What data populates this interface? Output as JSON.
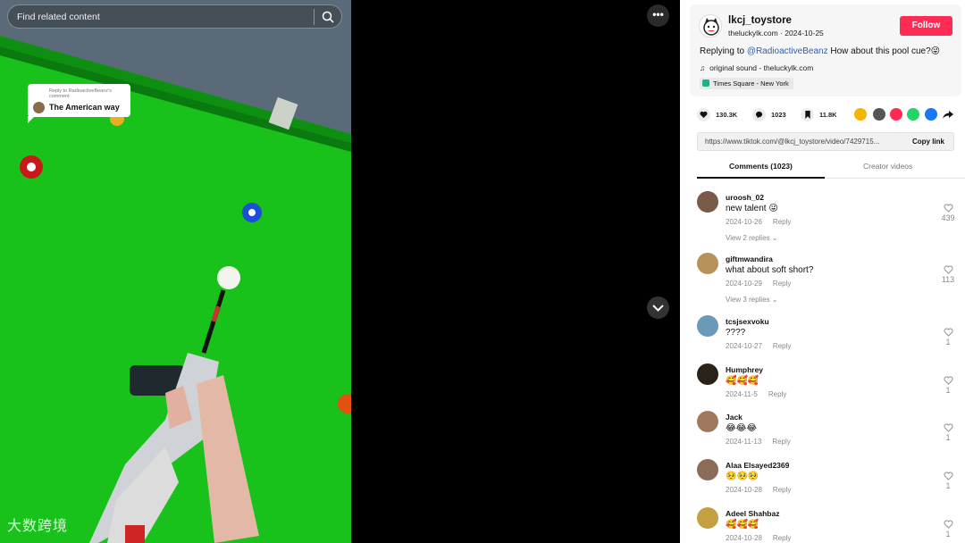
{
  "search": {
    "placeholder": "Find related content"
  },
  "reply_sticker": {
    "small": "Reply to RadioactiveBeanz's comment",
    "main": "The American way"
  },
  "watermark": "大数跨境",
  "controls": {
    "more": "•••"
  },
  "post": {
    "author": "lkcj_toystore",
    "subtitle": "theluckylk.com · 2024-10-25",
    "follow": "Follow",
    "caption_prefix": "Replying to ",
    "caption_mention": "@RadioactiveBeanz",
    "caption_text": " How about this pool cue?😜",
    "sound": "original sound - theluckylk.com",
    "location": "Times Square - New York"
  },
  "stats": {
    "likes": "130.3K",
    "comments": "1023",
    "saves": "11.8K"
  },
  "share_colors": [
    "#f6b400",
    "#555555",
    "#fe2c55",
    "#25d366",
    "#1877f2"
  ],
  "link": {
    "url": "https://www.tiktok.com/@lkcj_toystore/video/7429715...",
    "copy": "Copy link"
  },
  "tabs": {
    "comments": "Comments (1023)",
    "creator": "Creator videos"
  },
  "comments": [
    {
      "user": "uroosh_02",
      "text": "new talent 😜",
      "date": "2024-10-26",
      "reply": "Reply",
      "likes": "439",
      "replies": "View 2 replies",
      "avatar_color": "#7a5a48"
    },
    {
      "user": "giftmwandira",
      "text": "what about soft short?",
      "date": "2024-10-29",
      "reply": "Reply",
      "likes": "113",
      "replies": "View 3 replies",
      "avatar_color": "#b8905a"
    },
    {
      "user": "tcsjsexvoku",
      "text": "????",
      "date": "2024-10-27",
      "reply": "Reply",
      "likes": "1",
      "replies": "",
      "avatar_color": "#6a9ab8"
    },
    {
      "user": "Humphrey",
      "text": "🥰🥰🥰",
      "date": "2024-11-5",
      "reply": "Reply",
      "likes": "1",
      "replies": "",
      "avatar_color": "#2a2218"
    },
    {
      "user": "Jack",
      "text": "😂😂😂",
      "date": "2024-11-13",
      "reply": "Reply",
      "likes": "1",
      "replies": "",
      "avatar_color": "#a07860"
    },
    {
      "user": "Alaa Elsayed2369",
      "text": "🥺🥺🥺",
      "date": "2024-10-28",
      "reply": "Reply",
      "likes": "1",
      "replies": "",
      "avatar_color": "#8a6c58"
    },
    {
      "user": "Adeel Shahbaz",
      "text": "🥰🥰🥰",
      "date": "2024-10-28",
      "reply": "Reply",
      "likes": "1",
      "replies": "",
      "avatar_color": "#c4a040"
    }
  ]
}
